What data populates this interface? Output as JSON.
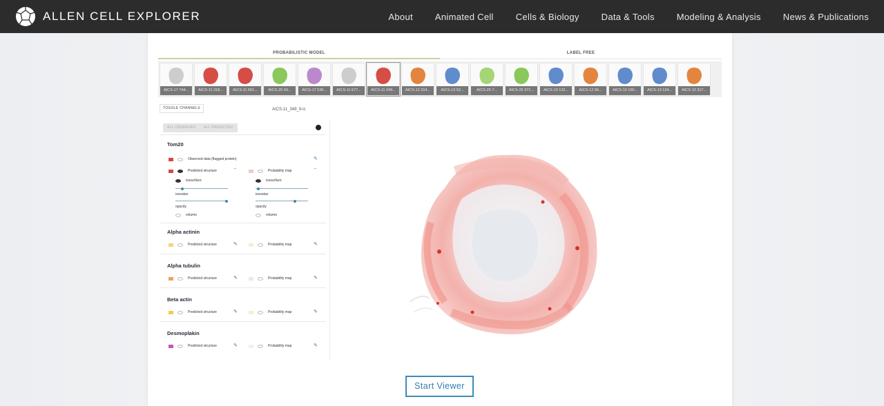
{
  "brand": {
    "name": "ALLEN CELL EXPLORER"
  },
  "nav": {
    "items": [
      "About",
      "Animated Cell",
      "Cells & Biology",
      "Data & Tools",
      "Modeling & Analysis",
      "News & Publications"
    ]
  },
  "tabs": [
    "PROBABILISTIC MODEL",
    "LABEL FREE"
  ],
  "thumbnails": [
    {
      "caption": "AICS-17 744...",
      "color": "#c8c8c8"
    },
    {
      "caption": "AICS-11 318...",
      "color": "#d23a32"
    },
    {
      "caption": "AICS-11 561...",
      "color": "#d23a32"
    },
    {
      "caption": "AICS-25 43...",
      "color": "#7dc24a"
    },
    {
      "caption": "AICS-17 536...",
      "color": "#b57bc8"
    },
    {
      "caption": "AICS-11 677...",
      "color": "#c8c8c8"
    },
    {
      "caption": "AICS-11 349...",
      "color": "#d23a32"
    },
    {
      "caption": "AICS-12 314...",
      "color": "#e0782a"
    },
    {
      "caption": "AICS-13 52...",
      "color": "#4f7fc8"
    },
    {
      "caption": "AICS-25 7...",
      "color": "#9bd067"
    },
    {
      "caption": "AICS-25 371...",
      "color": "#7dc24a"
    },
    {
      "caption": "AICS-13 122...",
      "color": "#4f7fc8"
    },
    {
      "caption": "AICS-12 96...",
      "color": "#e0782a"
    },
    {
      "caption": "AICS-13 100...",
      "color": "#4f7fc8"
    },
    {
      "caption": "AICS-13 124...",
      "color": "#4f7fc8"
    },
    {
      "caption": "AICS-12 317...",
      "color": "#e0782a"
    }
  ],
  "controls": {
    "toggle_channels": "TOGGLE CHANNELS",
    "cell_id": "AICS-11_349_9-ic",
    "all_observed": "ALL OBSERVED",
    "all_predicted": "ALL PREDICTED",
    "tom20": {
      "title": "Tom20",
      "observed_label": "Observed data (flagged protein)",
      "predicted_label": "Predicted structure",
      "probability_label": "Probability map",
      "isosurface": "isosurface",
      "isovalue": "isovalue",
      "opacity": "opacity",
      "volume": "volume"
    },
    "groups": [
      {
        "title": "Alpha actinin",
        "predicted": "Predicted structure",
        "probability": "Probability map",
        "color": "#f5d57a",
        "light": "#f3efd8"
      },
      {
        "title": "Alpha tubulin",
        "predicted": "Predicted structure",
        "probability": "Probability map",
        "color": "#f0a05a",
        "light": "#f3e8dc"
      },
      {
        "title": "Beta actin",
        "predicted": "Predicted structure",
        "probability": "Probability map",
        "color": "#f5cc4a",
        "light": "#f3efd8"
      },
      {
        "title": "Desmoplakin",
        "predicted": "Predicted structure",
        "probability": "Probability map",
        "color": "#d050b8",
        "light": "#f0f0f0"
      }
    ]
  },
  "start_viewer": "Start Viewer",
  "colors": {
    "nav_bg": "#2c2c2c",
    "accent": "#3e8ab8",
    "tom20": "#d8473f"
  }
}
